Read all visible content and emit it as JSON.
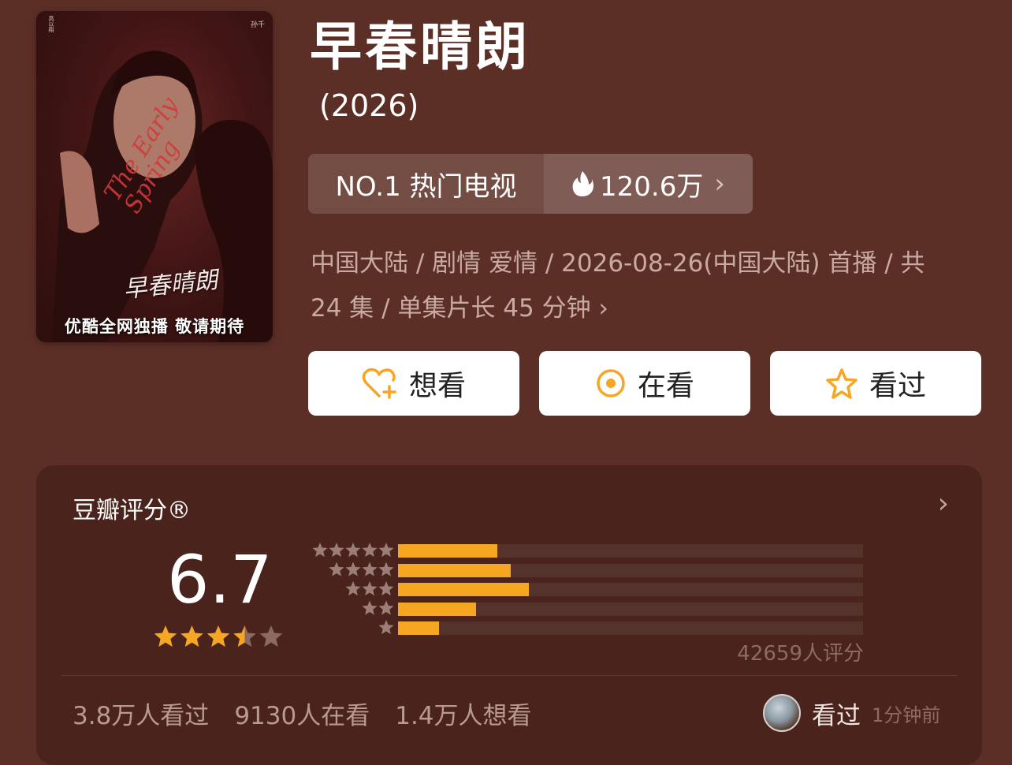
{
  "poster": {
    "tagline": "优酷全网独播 敬请期待",
    "script_title": "早春晴朗",
    "english_title": "The Early Spring",
    "cast_right": "孙千",
    "cast_left": "高以翔"
  },
  "title": "早春晴朗",
  "year": "(2026)",
  "rank": {
    "label": "NO.1 热门电视",
    "heat": "120.6万",
    "flame_icon": "flame-icon",
    "chevron_icon": "chevron-right-icon"
  },
  "meta": {
    "line1": "中国大陆 / 剧情 爱情 / 2026-08-26(中国大陆) 首播 / 共",
    "line2": "24 集 / 单集片长 45 分钟"
  },
  "actions": [
    {
      "label": "想看",
      "icon": "heart-plus-icon"
    },
    {
      "label": "在看",
      "icon": "target-icon"
    },
    {
      "label": "看过",
      "icon": "star-outline-icon"
    }
  ],
  "rating": {
    "title": "豆瓣评分®",
    "score": "6.7",
    "stars": 3.5,
    "distribution": [
      {
        "stars": 5,
        "fraction": 0.214
      },
      {
        "stars": 4,
        "fraction": 0.243
      },
      {
        "stars": 3,
        "fraction": 0.281
      },
      {
        "stars": 2,
        "fraction": 0.167
      },
      {
        "stars": 1,
        "fraction": 0.088
      }
    ],
    "count": "42659人评分",
    "accent": "#f5a623"
  },
  "stats": {
    "watched": "3.8万人看过",
    "watching": "9130人在看",
    "want": "1.4万人想看"
  },
  "friend": {
    "action": "看过",
    "time": "1分钟前"
  }
}
